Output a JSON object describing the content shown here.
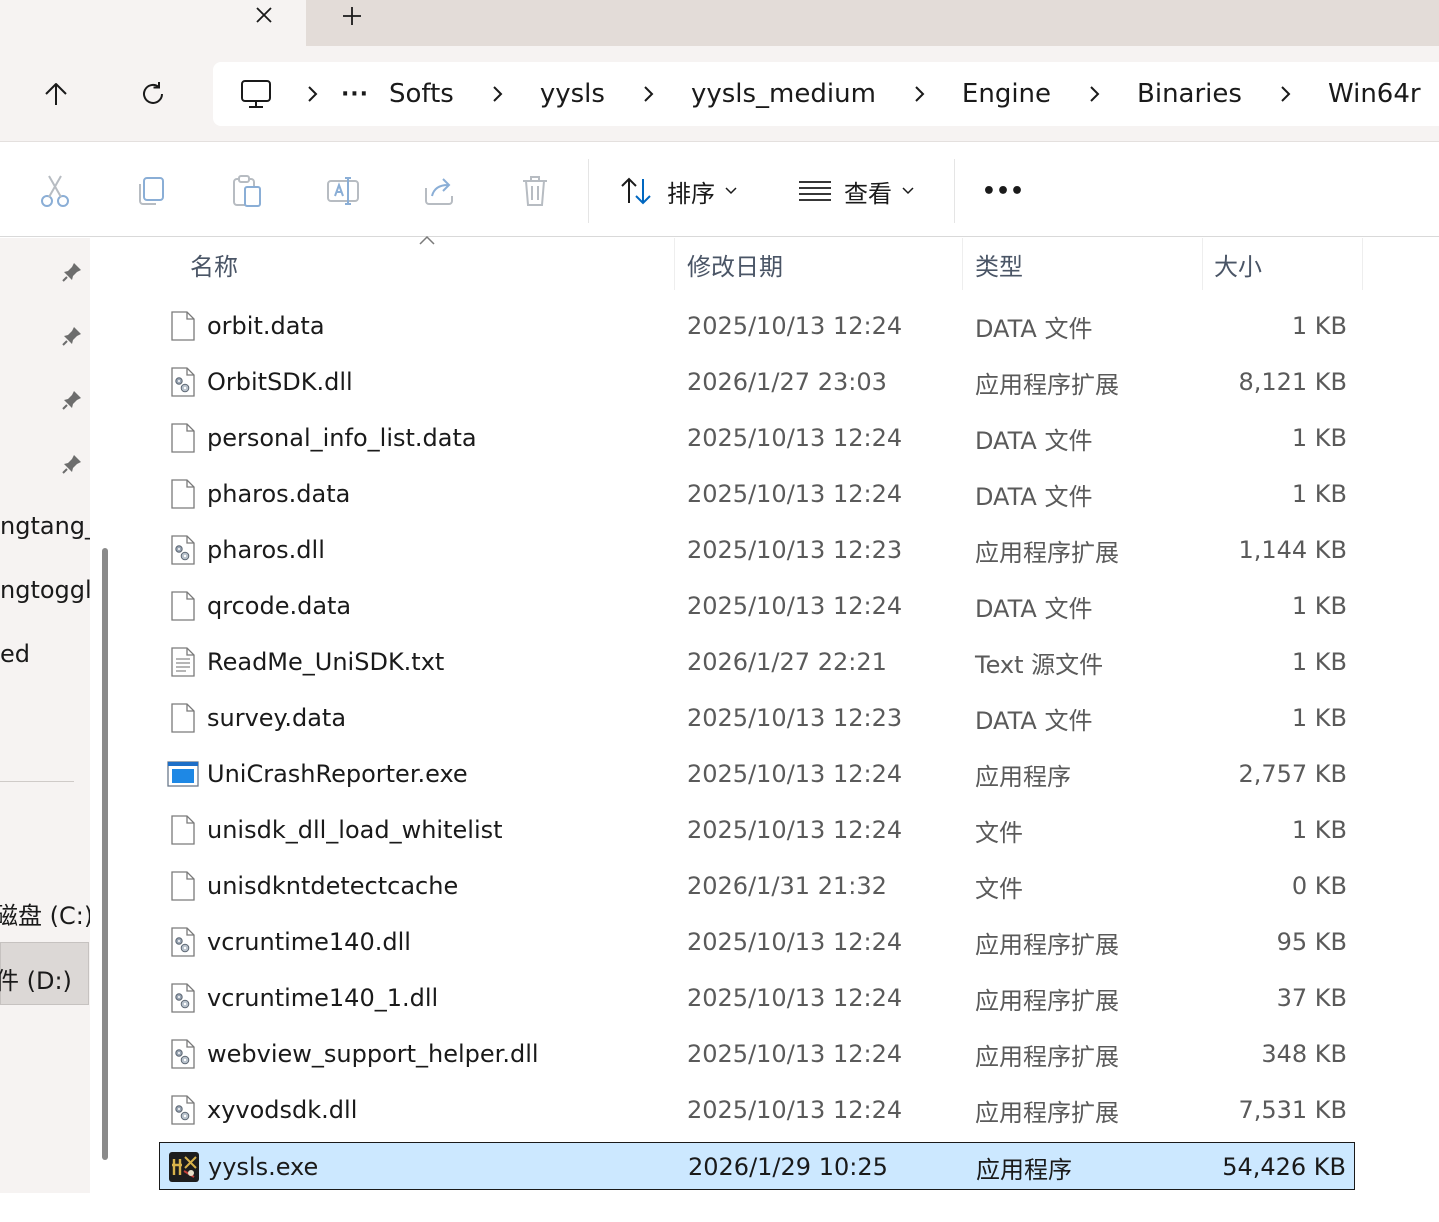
{
  "window": {
    "tab_close_glyph": "✕",
    "new_tab_glyph": "+"
  },
  "breadcrumb": {
    "overflow": "···",
    "items": [
      "Softs",
      "yysls",
      "yysls_medium",
      "Engine",
      "Binaries",
      "Win64r"
    ]
  },
  "commands": {
    "sort_label": "排序",
    "view_label": "查看",
    "more_glyph": "•••"
  },
  "nav_pane": {
    "items": [
      "ngtang_",
      "ngtoggle",
      "ed",
      "磁盘 (C:)",
      "件 (D:)"
    ]
  },
  "columns": {
    "name": "名称",
    "date": "修改日期",
    "type": "类型",
    "size": "大小"
  },
  "files": [
    {
      "name": "orbit.data",
      "date": "2025/10/13 12:24",
      "type": "DATA 文件",
      "size": "1 KB",
      "icon": "blank-file-icon"
    },
    {
      "name": "OrbitSDK.dll",
      "date": "2026/1/27 23:03",
      "type": "应用程序扩展",
      "size": "8,121 KB",
      "icon": "dll-file-icon"
    },
    {
      "name": "personal_info_list.data",
      "date": "2025/10/13 12:24",
      "type": "DATA 文件",
      "size": "1 KB",
      "icon": "blank-file-icon"
    },
    {
      "name": "pharos.data",
      "date": "2025/10/13 12:24",
      "type": "DATA 文件",
      "size": "1 KB",
      "icon": "blank-file-icon"
    },
    {
      "name": "pharos.dll",
      "date": "2025/10/13 12:23",
      "type": "应用程序扩展",
      "size": "1,144 KB",
      "icon": "dll-file-icon"
    },
    {
      "name": "qrcode.data",
      "date": "2025/10/13 12:24",
      "type": "DATA 文件",
      "size": "1 KB",
      "icon": "blank-file-icon"
    },
    {
      "name": "ReadMe_UniSDK.txt",
      "date": "2026/1/27 22:21",
      "type": "Text 源文件",
      "size": "1 KB",
      "icon": "text-file-icon"
    },
    {
      "name": "survey.data",
      "date": "2025/10/13 12:23",
      "type": "DATA 文件",
      "size": "1 KB",
      "icon": "blank-file-icon"
    },
    {
      "name": "UniCrashReporter.exe",
      "date": "2025/10/13 12:24",
      "type": "应用程序",
      "size": "2,757 KB",
      "icon": "exe-window-icon"
    },
    {
      "name": "unisdk_dll_load_whitelist",
      "date": "2025/10/13 12:24",
      "type": "文件",
      "size": "1 KB",
      "icon": "blank-file-icon"
    },
    {
      "name": "unisdkntdetectcache",
      "date": "2026/1/31 21:32",
      "type": "文件",
      "size": "0 KB",
      "icon": "blank-file-icon"
    },
    {
      "name": "vcruntime140.dll",
      "date": "2025/10/13 12:24",
      "type": "应用程序扩展",
      "size": "95 KB",
      "icon": "dll-file-icon"
    },
    {
      "name": "vcruntime140_1.dll",
      "date": "2025/10/13 12:24",
      "type": "应用程序扩展",
      "size": "37 KB",
      "icon": "dll-file-icon"
    },
    {
      "name": "webview_support_helper.dll",
      "date": "2025/10/13 12:24",
      "type": "应用程序扩展",
      "size": "348 KB",
      "icon": "dll-file-icon"
    },
    {
      "name": "xyvodsdk.dll",
      "date": "2025/10/13 12:24",
      "type": "应用程序扩展",
      "size": "7,531 KB",
      "icon": "dll-file-icon"
    },
    {
      "name": "yysls.exe",
      "date": "2026/1/29 10:25",
      "type": "应用程序",
      "size": "54,426 KB",
      "icon": "game-app-icon",
      "selected": true
    }
  ],
  "colors": {
    "accent": "#0067c0",
    "selection_bg": "#cce8ff",
    "chrome_bg": "#f6f3f2"
  }
}
